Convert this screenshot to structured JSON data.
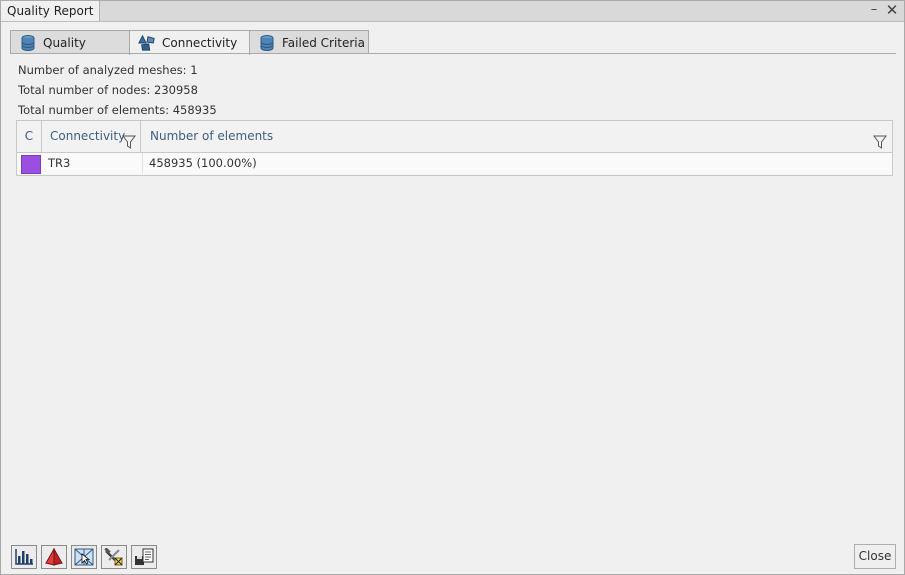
{
  "window": {
    "title": "Quality Report"
  },
  "tabs": [
    {
      "label": "Quality",
      "icon": "database-icon"
    },
    {
      "label": "Connectivity",
      "icon": "connectivity-shapes-icon",
      "active": true
    },
    {
      "label": "Failed Criteria",
      "icon": "database-icon"
    }
  ],
  "stats": {
    "meshes": "Number of analyzed meshes: 1",
    "nodes": "Total number of nodes: 230958",
    "elements": "Total number of elements: 458935"
  },
  "grid": {
    "columns": [
      "C",
      "Connectivity",
      "Number of elements"
    ],
    "rows": [
      {
        "color": "#9b4fe0",
        "connectivity": "TR3",
        "elements": "458935 (100.00%)"
      }
    ]
  },
  "toolbar": {
    "icons": [
      "histogram-icon",
      "pyramid-icon",
      "select-elements-icon",
      "tools-icon",
      "save-report-icon"
    ]
  },
  "footer": {
    "close_label": "Close"
  }
}
